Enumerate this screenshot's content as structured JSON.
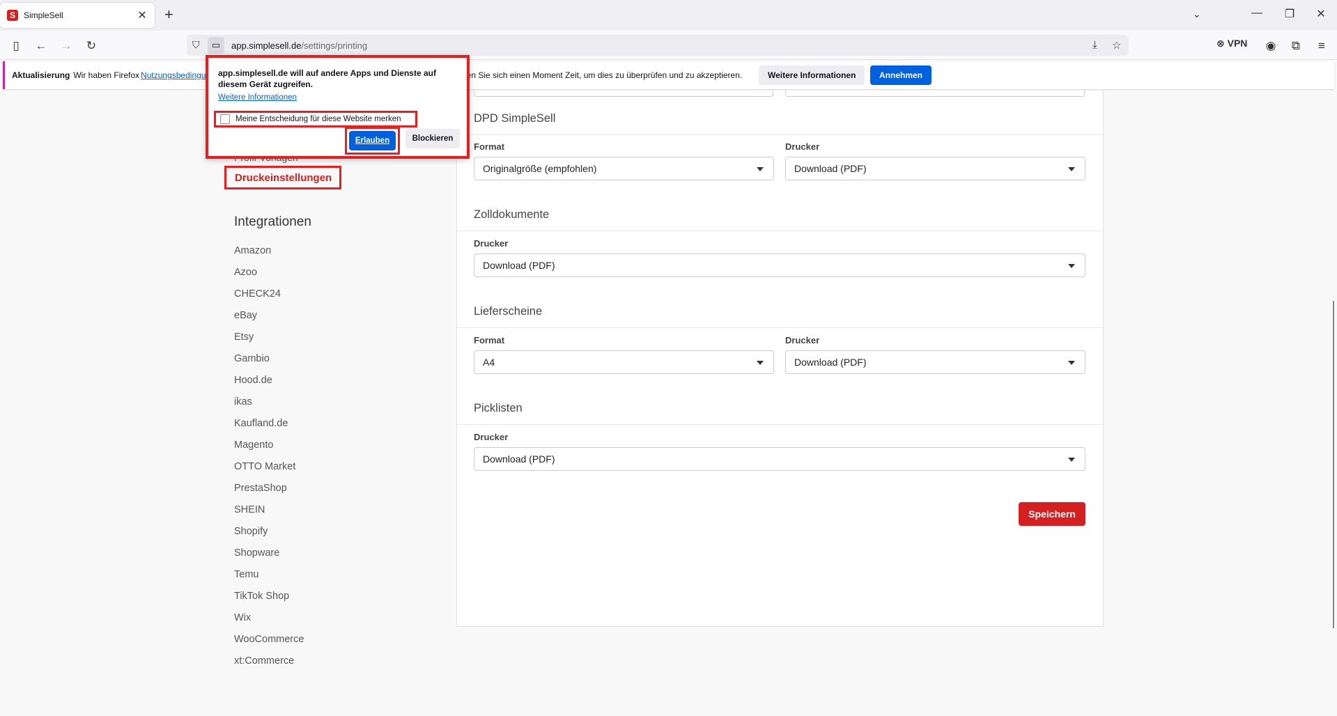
{
  "browser": {
    "tab_title": "SimpleSell",
    "tab_favicon_letter": "S",
    "new_tab": "+",
    "url_domain": "app.simplesell.de",
    "url_path": "/settings/printing",
    "vpn_label": "VPN"
  },
  "notification": {
    "title": "Aktualisierung",
    "text_start": "Wir haben Firefox",
    "link": "Nutzungsbedingungen",
    "text_end": "nen Sie sich einen Moment Zeit, um dies zu überprüfen und zu akzeptieren.",
    "more_info": "Weitere Informationen",
    "accept": "Annehmen"
  },
  "permission_popup": {
    "message": "app.simplesell.de will auf andere Apps und Dienste auf diesem Gerät zugreifen.",
    "link": "Weitere Informationen",
    "remember": "Meine Entscheidung für diese Website merken",
    "allow": "Erlauben",
    "block": "Blockieren"
  },
  "sidebar": {
    "partial_item": "Profil-Vorlagen",
    "active_item": "Druckeinstellungen",
    "integrations_heading": "Integrationen",
    "integrations": [
      "Amazon",
      "Azoo",
      "CHECK24",
      "eBay",
      "Etsy",
      "Gambio",
      "Hood.de",
      "ikas",
      "Kaufland.de",
      "Magento",
      "OTTO Market",
      "PrestaShop",
      "SHEIN",
      "Shopify",
      "Shopware",
      "Temu",
      "TikTok Shop",
      "Wix",
      "WooCommerce",
      "xt:Commerce"
    ]
  },
  "settings": {
    "dpd": {
      "title": "DPD SimpleSell",
      "format_label": "Format",
      "format_value": "Originalgröße (empfohlen)",
      "printer_label": "Drucker",
      "printer_value": "Download (PDF)"
    },
    "customs": {
      "title": "Zolldokumente",
      "printer_label": "Drucker",
      "printer_value": "Download (PDF)"
    },
    "delivery_notes": {
      "title": "Lieferscheine",
      "format_label": "Format",
      "format_value": "A4",
      "printer_label": "Drucker",
      "printer_value": "Download (PDF)"
    },
    "picklists": {
      "title": "Picklisten",
      "printer_label": "Drucker",
      "printer_value": "Download (PDF)"
    },
    "save": "Speichern"
  }
}
